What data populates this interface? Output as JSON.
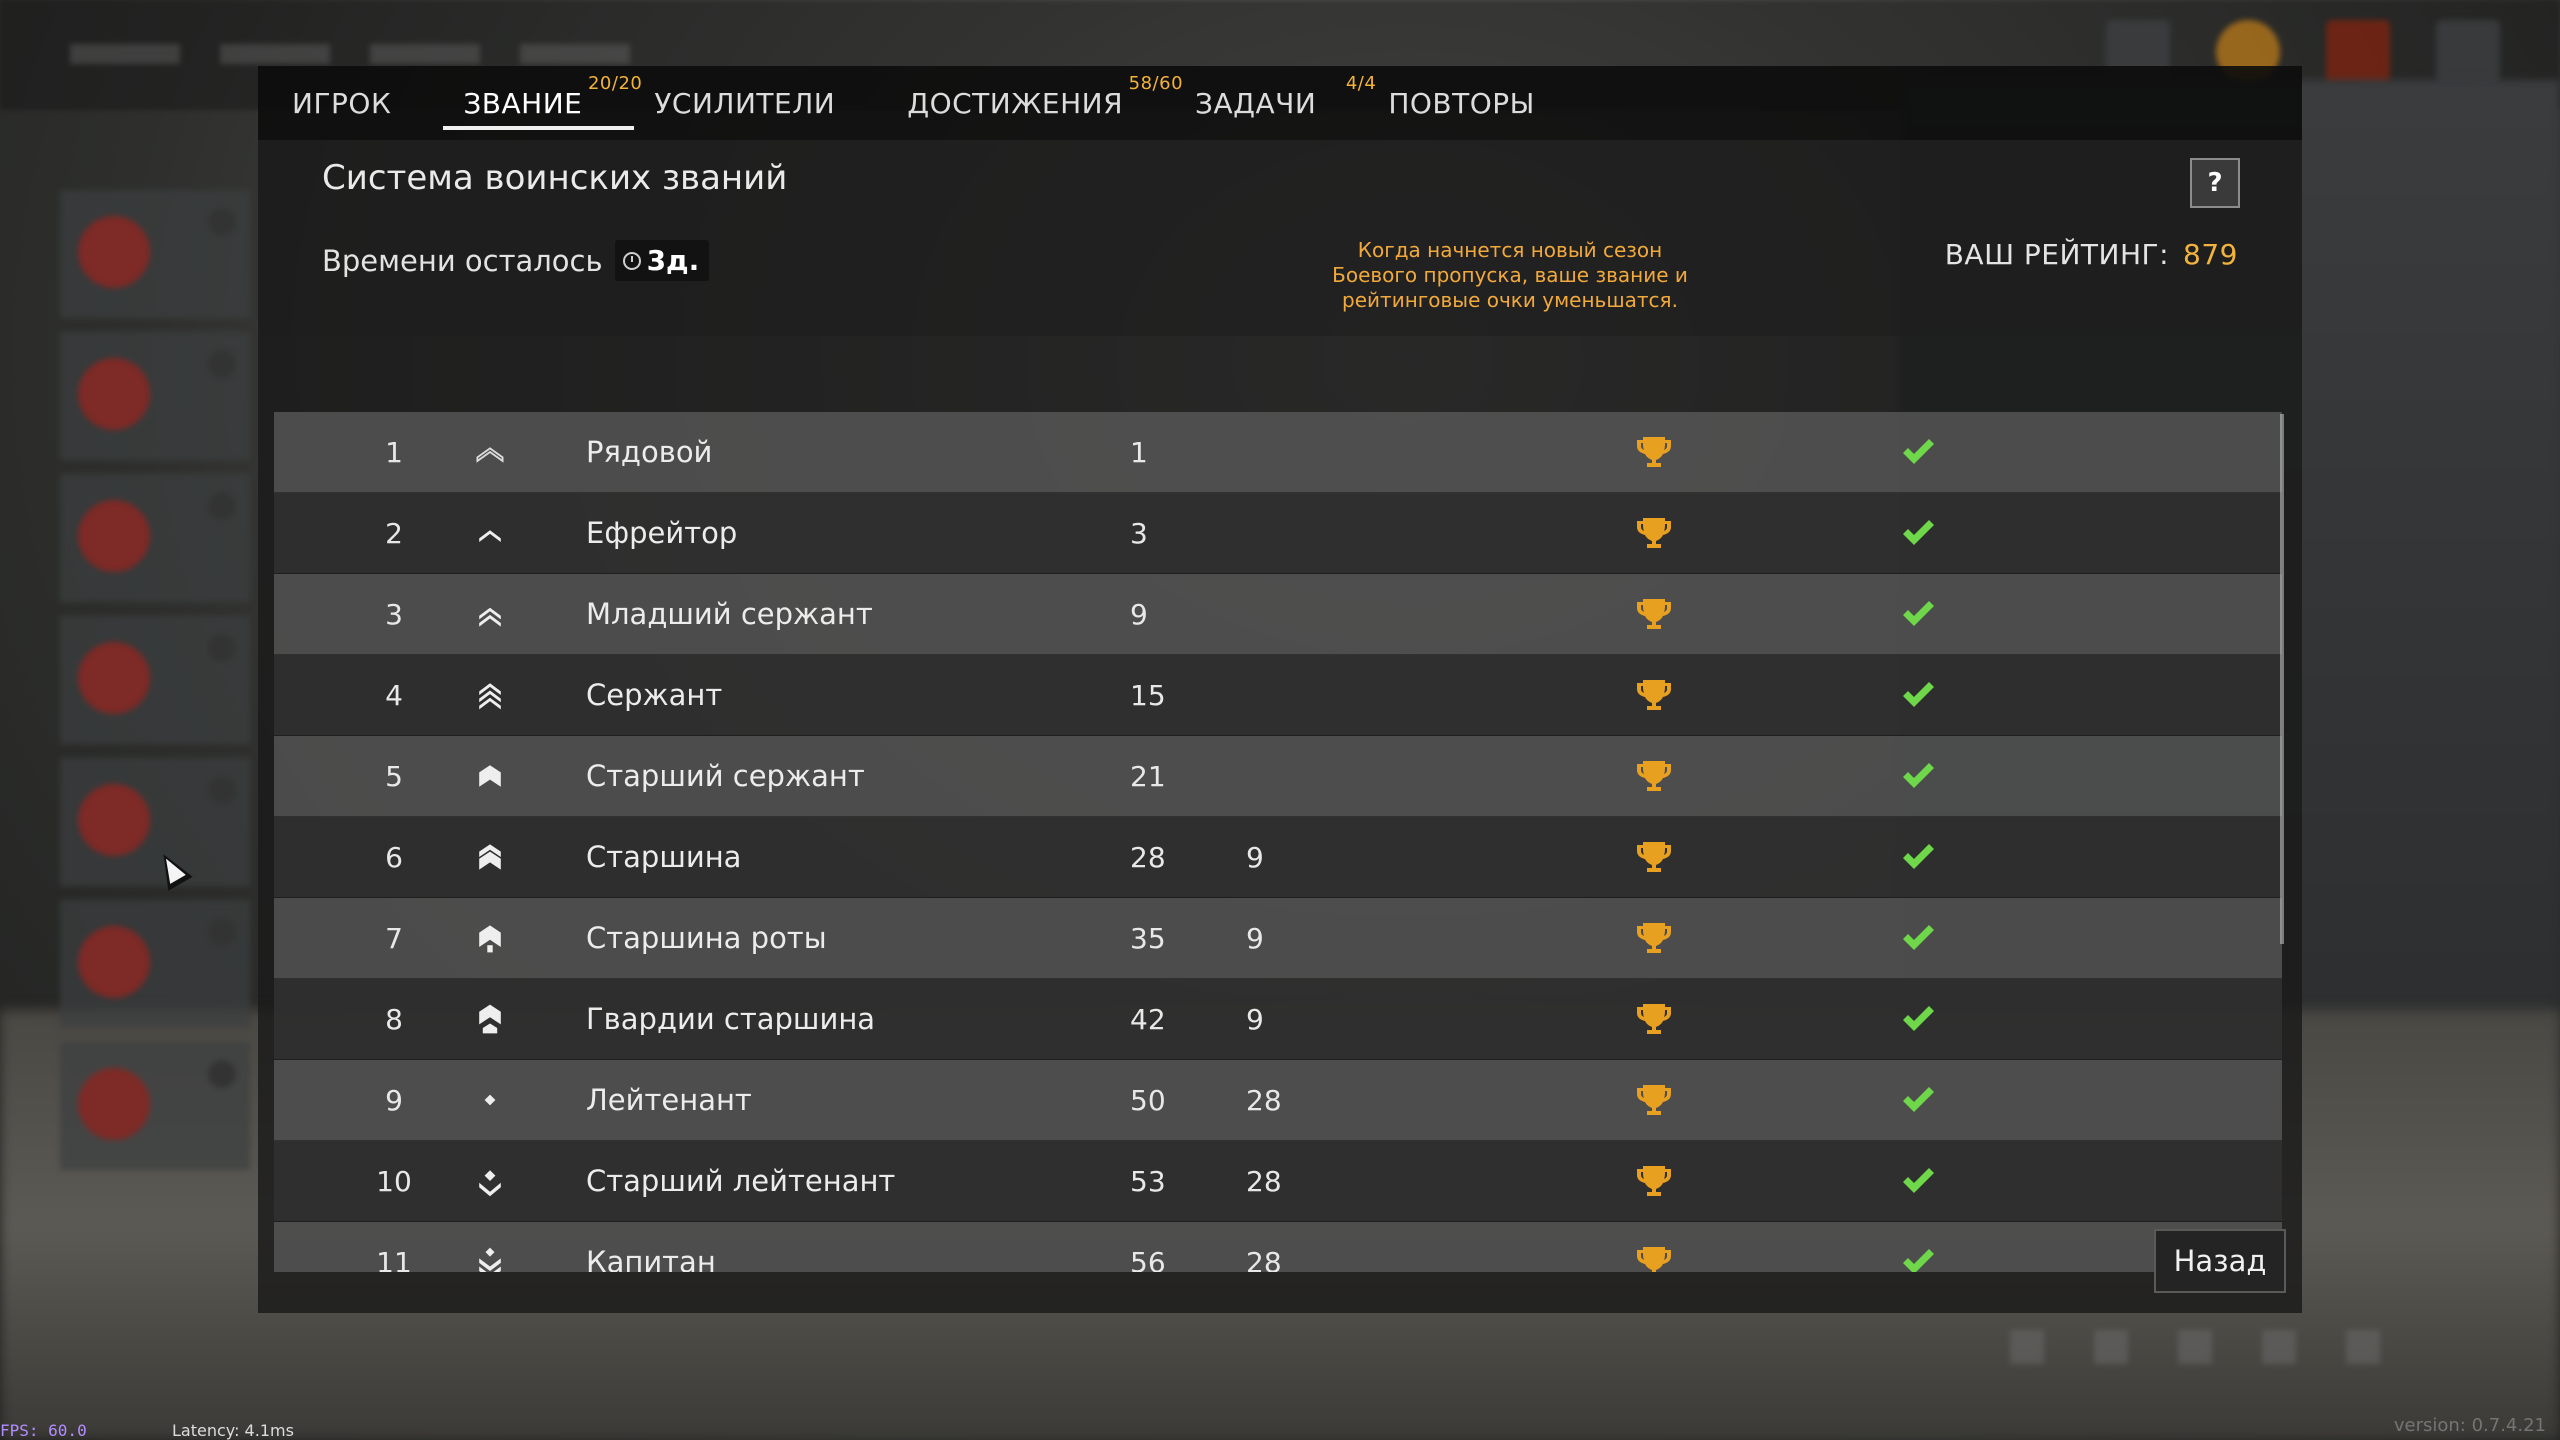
{
  "tabs": [
    {
      "label": "ИГРОК",
      "badge": ""
    },
    {
      "label": "ЗВАНИЕ",
      "badge": "20/20"
    },
    {
      "label": "УСИЛИТЕЛИ",
      "badge": ""
    },
    {
      "label": "ДОСТИЖЕНИЯ",
      "badge": "58/60"
    },
    {
      "label": "ЗАДАЧИ",
      "badge": "4/4"
    },
    {
      "label": "ПОВТОРЫ",
      "badge": ""
    }
  ],
  "active_tab": "ЗВАНИЕ",
  "page_title": "Система воинских званий",
  "help_label": "?",
  "time_left_label": "Времени осталось",
  "time_left_value": "3д.",
  "season_note": "Когда начнется новый сезон Боевого пропуска, ваше звание и рейтинговые очки уменьшатся.",
  "rating_label": "ВАШ РЕЙТИНГ:",
  "rating_value": "879",
  "ranks": [
    {
      "num": "1",
      "name": "Рядовой",
      "pts": "1",
      "pts2": "",
      "icon": "private-insignia-icon"
    },
    {
      "num": "2",
      "name": "Ефрейтор",
      "pts": "3",
      "pts2": "",
      "icon": "corporal-insignia-icon"
    },
    {
      "num": "3",
      "name": "Младший сержант",
      "pts": "9",
      "pts2": "",
      "icon": "junior-sergeant-insignia-icon"
    },
    {
      "num": "4",
      "name": "Сержант",
      "pts": "15",
      "pts2": "",
      "icon": "sergeant-insignia-icon"
    },
    {
      "num": "5",
      "name": "Старший сержант",
      "pts": "21",
      "pts2": "",
      "icon": "senior-sergeant-insignia-icon"
    },
    {
      "num": "6",
      "name": "Старшина",
      "pts": "28",
      "pts2": "9",
      "icon": "starshina-insignia-icon"
    },
    {
      "num": "7",
      "name": "Старшина роты",
      "pts": "35",
      "pts2": "9",
      "icon": "company-starshina-insignia-icon"
    },
    {
      "num": "8",
      "name": "Гвардии старшина",
      "pts": "42",
      "pts2": "9",
      "icon": "guards-starshina-insignia-icon"
    },
    {
      "num": "9",
      "name": "Лейтенант",
      "pts": "50",
      "pts2": "28",
      "icon": "lieutenant-insignia-icon"
    },
    {
      "num": "10",
      "name": "Старший лейтенант",
      "pts": "53",
      "pts2": "28",
      "icon": "senior-lieutenant-insignia-icon"
    },
    {
      "num": "11",
      "name": "Капитан",
      "pts": "56",
      "pts2": "28",
      "icon": "captain-insignia-icon"
    }
  ],
  "back_label": "Назад",
  "fps": "FPS: 60.0",
  "latency": "Latency: 4.1ms",
  "version": "version: 0.7.4.21",
  "colors": {
    "accent": "#f2b33c",
    "check": "#6fd84a",
    "trophy": "#e8a020"
  }
}
